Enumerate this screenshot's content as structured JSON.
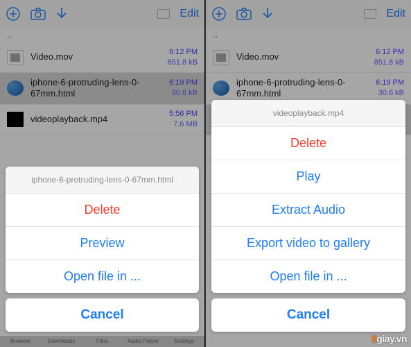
{
  "toolbar": {
    "edit_label": "Edit"
  },
  "up_dir": "..",
  "files": [
    {
      "name": "Video.mov",
      "time": "6:12 PM",
      "size": "851.8 kB"
    },
    {
      "name": "iphone-6-protruding-lens-0-67mm.html",
      "time": "6:19 PM",
      "size": "30.6 kB"
    },
    {
      "name": "videoplayback.mp4",
      "time": "5:56 PM",
      "size": "7.6 MB"
    }
  ],
  "left_sheet": {
    "title": "iphone-6-protruding-lens-0-67mm.html",
    "items": [
      {
        "label": "Delete",
        "destructive": true
      },
      {
        "label": "Preview"
      },
      {
        "label": "Open file in ..."
      }
    ],
    "cancel": "Cancel"
  },
  "right_sheet": {
    "title": "videoplayback.mp4",
    "items": [
      {
        "label": "Delete",
        "destructive": true
      },
      {
        "label": "Play"
      },
      {
        "label": "Extract Audio"
      },
      {
        "label": "Export video to gallery"
      },
      {
        "label": "Open file in ..."
      }
    ],
    "cancel": "Cancel"
  },
  "tabs": [
    "Browser",
    "Downloads",
    "Files",
    "Audio Player",
    "Settings"
  ],
  "watermark": "5giay.vn"
}
